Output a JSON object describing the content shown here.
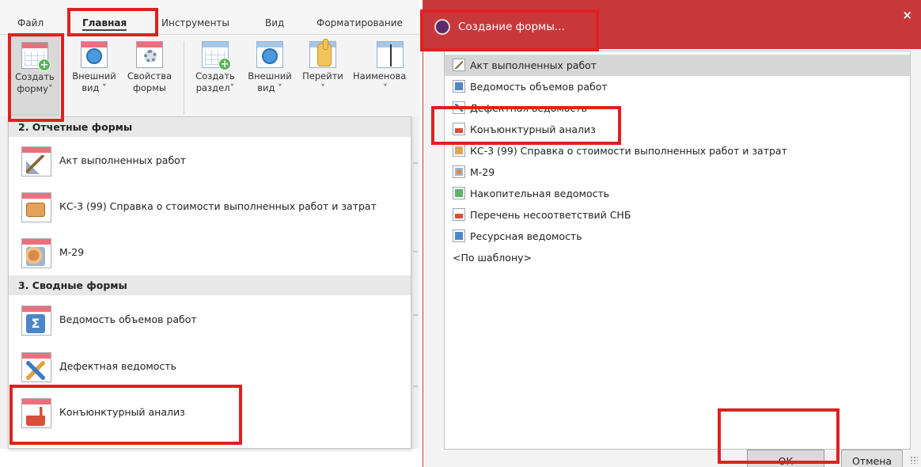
{
  "menubar": {
    "tabs": [
      {
        "label": "Файл"
      },
      {
        "label": "Главная"
      },
      {
        "label": "Инструменты"
      },
      {
        "label": "Вид"
      },
      {
        "label": "Форматирование"
      }
    ]
  },
  "ribbon": {
    "buttons": [
      {
        "line1": "Создать",
        "line2": "форму˅"
      },
      {
        "line1": "Внешний",
        "line2": "вид ˅"
      },
      {
        "line1": "Свойства",
        "line2": "формы"
      },
      {
        "line1": "Создать",
        "line2": "раздел˅"
      },
      {
        "line1": "Внешний",
        "line2": "вид ˅"
      },
      {
        "line1": "Перейти",
        "line2": "˅"
      },
      {
        "line1": "Наименова",
        "line2": "˅"
      }
    ]
  },
  "dropdown": {
    "groups": [
      {
        "title": "2. Отчетные формы"
      },
      {
        "title": "3. Сводные формы"
      }
    ],
    "items": [
      {
        "label": "Акт выполненных работ",
        "icon": "shovel-icon"
      },
      {
        "label": "КС-3 (99) Справка о стоимости выполненных работ и затрат",
        "icon": "wallet-icon"
      },
      {
        "label": "М-29",
        "icon": "materials-icon"
      },
      {
        "label": "Ведомость объемов работ",
        "icon": "sum-icon"
      },
      {
        "label": "Дефектная ведомость",
        "icon": "tools-icon"
      },
      {
        "label": "Конъюнктурный анализ",
        "icon": "factory-icon"
      }
    ]
  },
  "dialog": {
    "title": "Создание формы...",
    "close": "×",
    "list": [
      {
        "label": "Акт выполненных работ",
        "icon": "shovel-icon"
      },
      {
        "label": "Ведомость объемов работ",
        "icon": "sum-icon"
      },
      {
        "label": "Дефектная ведомость",
        "icon": "tools-icon"
      },
      {
        "label": "Конъюнктурный анализ",
        "icon": "factory-icon"
      },
      {
        "label": "КС-3 (99) Справка о стоимости выполненных работ и затрат",
        "icon": "wallet-icon"
      },
      {
        "label": "М-29",
        "icon": "materials-icon"
      },
      {
        "label": "Накопительная ведомость",
        "icon": "ledger-icon"
      },
      {
        "label": "Перечень несоответствий СНБ",
        "icon": "factory-icon"
      },
      {
        "label": "Ресурсная ведомость",
        "icon": "sum-icon"
      },
      {
        "label": "<По шаблону>",
        "icon": ""
      }
    ],
    "ok": "ОК",
    "cancel": "Отмена"
  },
  "colors": {
    "accent_red": "#c8383a",
    "highlight_box": "#e02020",
    "selected_row": "#d6d6d6"
  }
}
